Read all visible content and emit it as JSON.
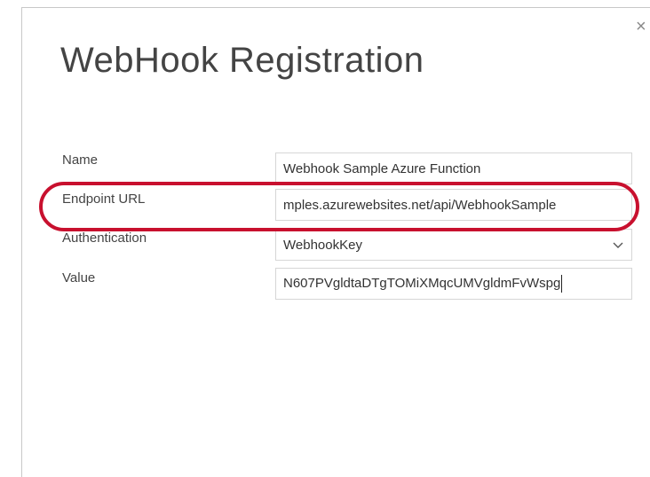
{
  "dialog": {
    "title": "WebHook Registration",
    "close_glyph": "×"
  },
  "form": {
    "name_label": "Name",
    "name_value": "Webhook Sample Azure Function",
    "endpoint_label": "Endpoint URL",
    "endpoint_value": "mples.azurewebsites.net/api/WebhookSample",
    "auth_label": "Authentication",
    "auth_value": "WebhookKey",
    "value_label": "Value",
    "value_value": "N607PVgldtaDTgTOMiXMqcUMVgldmFvWspg"
  },
  "annotation": {
    "highlight_color": "#c8102e"
  },
  "icons": {
    "close": "close-icon",
    "dropdown": "chevron-down-icon"
  }
}
